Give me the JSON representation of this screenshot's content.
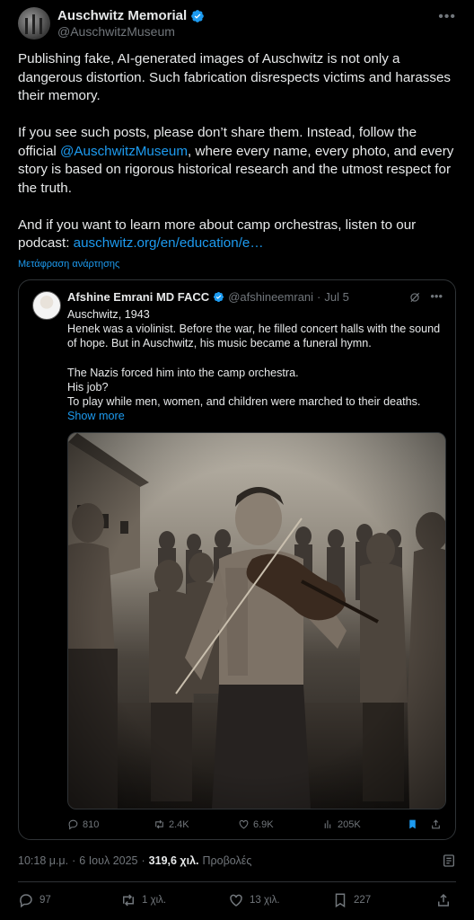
{
  "author": {
    "name": "Auschwitz Memorial",
    "handle": "@AuschwitzMuseum"
  },
  "post": {
    "p1": "Publishing fake, AI-generated images of Auschwitz is not only a dangerous distortion. Such fabrication disrespects victims and harasses their memory.",
    "p2_before": "If you see such posts, please don’t share them. Instead, follow the official ",
    "p2_mention": "@AuschwitzMuseum",
    "p2_after": ", where every name, every photo, and every story is based on rigorous historical research and the utmost respect for the truth.",
    "p3_before": "And if you want to learn more about camp orchestras, listen to our podcast: ",
    "p3_link": "auschwitz.org/en/education/e…",
    "translate_label": "Μετάφραση ανάρτησης"
  },
  "quote": {
    "name": "Afshine Emrani MD FACC",
    "handle": "@afshineemrani",
    "dot": "·",
    "date": "Jul 5",
    "lines": [
      "Auschwitz, 1943",
      "Henek was a violinist. Before the war, he filled concert halls with the sound",
      "of hope.  But in Auschwitz, his music became a funeral hymn."
    ],
    "lines2": [
      "The Nazis forced him into the camp orchestra.",
      "His job?",
      "To play while men, women, and children were marched to their deaths."
    ],
    "show_more": "Show more",
    "stats": {
      "replies": "810",
      "reposts": "2.4K",
      "likes": "6.9K",
      "views": "205K"
    }
  },
  "meta": {
    "time": "10:18 μ.μ.",
    "dot": "·",
    "date": "6 Ιουλ 2025",
    "dot2": "·",
    "views_count": "319,6 χιλ.",
    "views_label": "Προβολές"
  },
  "actions": {
    "replies": "97",
    "reposts": "1 χιλ.",
    "likes": "13 χιλ.",
    "bookmarks": "227"
  },
  "colors": {
    "background": "#000000",
    "text": "#e7e9ea",
    "muted": "#71767b",
    "link": "#1d9bf0",
    "border": "#2f3336"
  }
}
